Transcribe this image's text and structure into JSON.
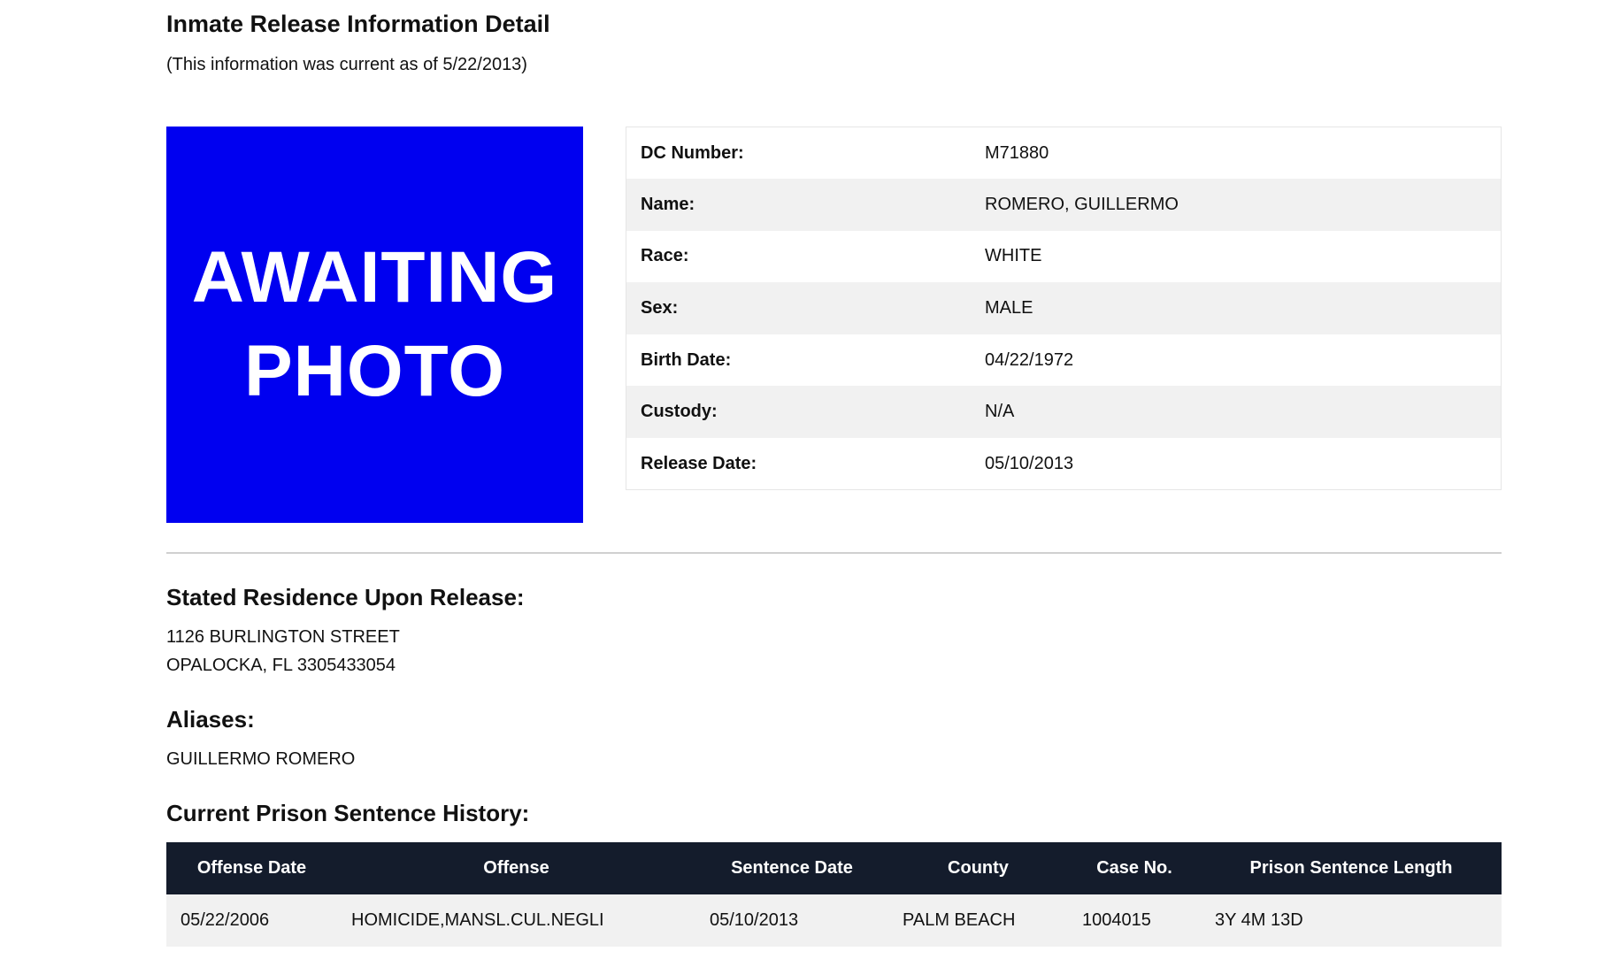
{
  "header": {
    "title": "Inmate Release Information Detail",
    "as_of": "(This information was current as of 5/22/2013)"
  },
  "photo": {
    "line1": "AWAITING",
    "line2": "PHOTO",
    "background_color": "#0000f0"
  },
  "details": [
    {
      "label": "DC Number:",
      "value": "M71880"
    },
    {
      "label": "Name:",
      "value": "ROMERO, GUILLERMO"
    },
    {
      "label": "Race:",
      "value": "WHITE"
    },
    {
      "label": "Sex:",
      "value": "MALE"
    },
    {
      "label": "Birth Date:",
      "value": "04/22/1972"
    },
    {
      "label": "Custody:",
      "value": "N/A"
    },
    {
      "label": "Release Date:",
      "value": "05/10/2013"
    }
  ],
  "residence": {
    "heading": "Stated Residence Upon Release:",
    "line1": "1126 BURLINGTON STREET",
    "line2": "OPALOCKA, FL 3305433054"
  },
  "aliases": {
    "heading": "Aliases:",
    "items": [
      "GUILLERMO ROMERO"
    ]
  },
  "sentence_history": {
    "heading": "Current Prison Sentence History:",
    "columns": [
      "Offense Date",
      "Offense",
      "Sentence Date",
      "County",
      "Case No.",
      "Prison Sentence Length"
    ],
    "rows": [
      [
        "05/22/2006",
        "HOMICIDE,MANSL.CUL.NEGLI",
        "05/10/2013",
        "PALM BEACH",
        "1004015",
        "3Y 4M 13D"
      ]
    ],
    "header_color": "#141c2c"
  }
}
